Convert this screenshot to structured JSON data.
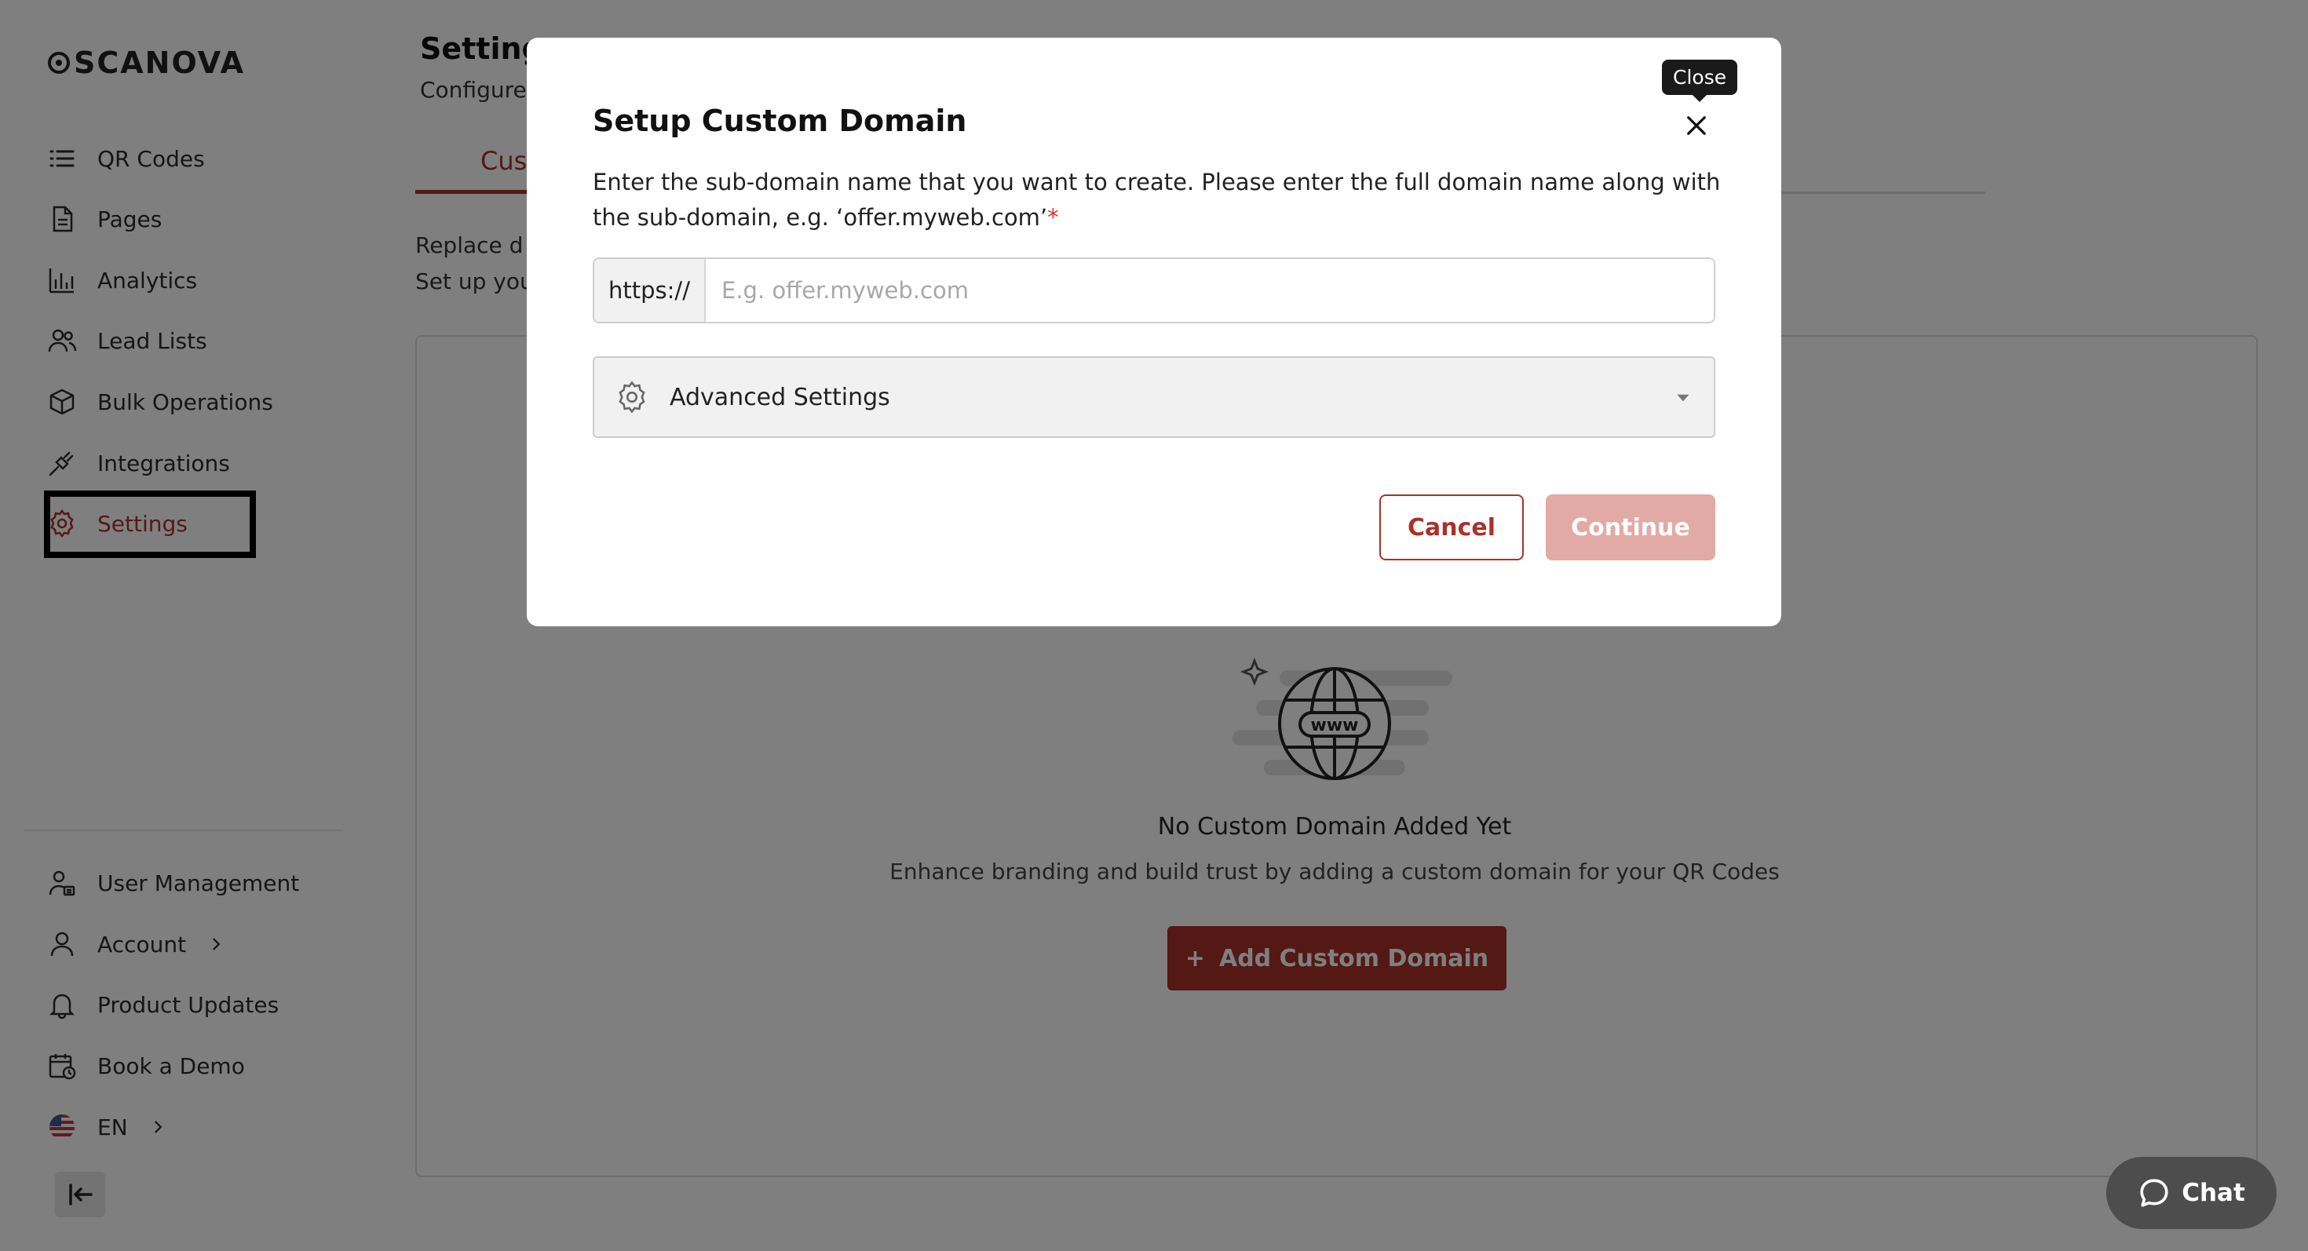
{
  "brand": {
    "name": "SCANOVA"
  },
  "sidebar": {
    "items": [
      {
        "label": "QR Codes",
        "icon": "list-icon"
      },
      {
        "label": "Pages",
        "icon": "document-icon"
      },
      {
        "label": "Analytics",
        "icon": "bar-chart-icon"
      },
      {
        "label": "Lead Lists",
        "icon": "users-icon"
      },
      {
        "label": "Bulk Operations",
        "icon": "cube-icon"
      },
      {
        "label": "Integrations",
        "icon": "plug-icon"
      },
      {
        "label": "Settings",
        "icon": "gear-icon",
        "active": true
      }
    ],
    "bottom_items": [
      {
        "label": "User Management",
        "icon": "user-manage-icon"
      },
      {
        "label": "Account",
        "icon": "user-icon"
      },
      {
        "label": "Product Updates",
        "icon": "bell-icon"
      },
      {
        "label": "Book a Demo",
        "icon": "calendar-icon"
      },
      {
        "label": "EN",
        "icon": "us-flag-icon"
      }
    ],
    "active_color": "#a8322a"
  },
  "page": {
    "title": "Settings",
    "subtitle": "Configure",
    "tab_label": "Cus",
    "desc_line1": "Replace d",
    "desc_line2": "Set up you"
  },
  "empty_state": {
    "title": "No Custom Domain Added Yet",
    "subtitle": "Enhance branding and build trust by adding a custom domain for your QR Codes",
    "button_label": "Add Custom Domain",
    "illustration_text": "www"
  },
  "modal": {
    "title": "Setup Custom Domain",
    "close_tooltip": "Close",
    "description": "Enter the sub-domain name that you want to create. Please enter the full domain name along with the sub-domain, e.g. ‘offer.myweb.com’",
    "required_mark": "*",
    "url_prefix": "https://",
    "url_placeholder": "E.g. offer.myweb.com",
    "url_value": "",
    "advanced_label": "Advanced Settings",
    "cancel_label": "Cancel",
    "continue_label": "Continue"
  },
  "chat": {
    "label": "Chat"
  },
  "colors": {
    "brand": "#a8322a",
    "continue_disabled": "#e2aaa5",
    "overlay": "rgba(0,0,0,0.5)"
  }
}
